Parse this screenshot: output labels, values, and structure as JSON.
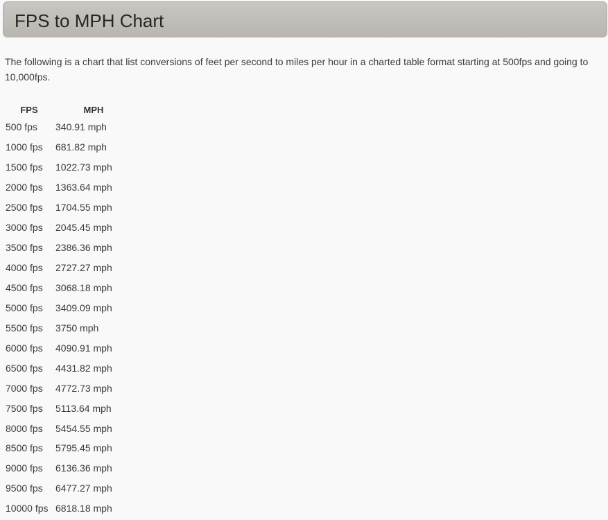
{
  "header": {
    "title": "FPS to MPH Chart"
  },
  "intro": {
    "text": "The following is a chart that list conversions of feet per second to miles per hour in a charted table format starting at 500fps and going to 10,000fps."
  },
  "table": {
    "headers": [
      "FPS",
      "MPH"
    ],
    "rows": [
      {
        "fps": "500 fps",
        "mph": "340.91 mph"
      },
      {
        "fps": "1000 fps",
        "mph": "681.82 mph"
      },
      {
        "fps": "1500 fps",
        "mph": "1022.73 mph"
      },
      {
        "fps": "2000 fps",
        "mph": "1363.64 mph"
      },
      {
        "fps": "2500 fps",
        "mph": "1704.55 mph"
      },
      {
        "fps": "3000 fps",
        "mph": "2045.45 mph"
      },
      {
        "fps": "3500 fps",
        "mph": "2386.36 mph"
      },
      {
        "fps": "4000 fps",
        "mph": "2727.27 mph"
      },
      {
        "fps": "4500 fps",
        "mph": "3068.18 mph"
      },
      {
        "fps": "5000 fps",
        "mph": "3409.09 mph"
      },
      {
        "fps": "5500 fps",
        "mph": "3750 mph"
      },
      {
        "fps": "6000 fps",
        "mph": "4090.91 mph"
      },
      {
        "fps": "6500 fps",
        "mph": "4431.82 mph"
      },
      {
        "fps": "7000 fps",
        "mph": "4772.73 mph"
      },
      {
        "fps": "7500 fps",
        "mph": "5113.64 mph"
      },
      {
        "fps": "8000 fps",
        "mph": "5454.55 mph"
      },
      {
        "fps": "8500 fps",
        "mph": "5795.45 mph"
      },
      {
        "fps": "9000 fps",
        "mph": "6136.36 mph"
      },
      {
        "fps": "9500 fps",
        "mph": "6477.27 mph"
      },
      {
        "fps": "10000 fps",
        "mph": "6818.18 mph"
      }
    ]
  }
}
